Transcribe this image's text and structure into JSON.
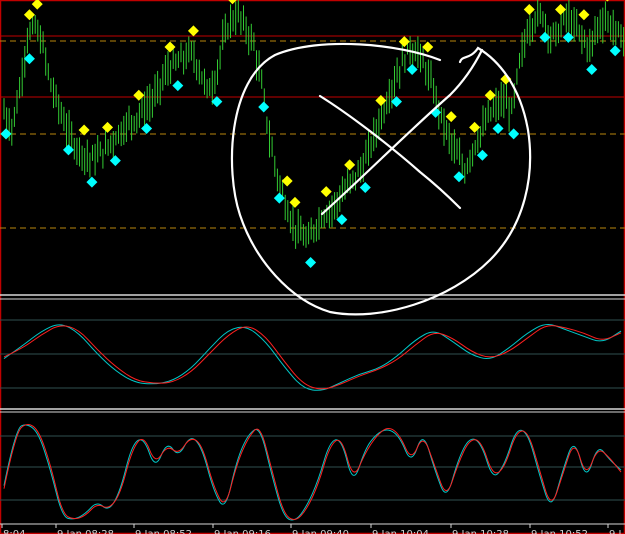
{
  "chart_data": [
    {
      "type": "candlestick",
      "panel": "price",
      "x_tick_labels": [
        "8:04",
        "9 Jan 08:28",
        "9 Jan 08:52",
        "9 Jan 09:16",
        "9 Jan 09:40",
        "9 Jan 10:04",
        "9 Jan 10:28",
        "9 Jan 10:52",
        "9 J"
      ],
      "close_trace": [
        0.62,
        0.56,
        0.7,
        0.9,
        0.94,
        0.86,
        0.72,
        0.64,
        0.56,
        0.5,
        0.47,
        0.44,
        0.46,
        0.48,
        0.52,
        0.55,
        0.58,
        0.6,
        0.64,
        0.66,
        0.72,
        0.78,
        0.8,
        0.82,
        0.84,
        0.78,
        0.7,
        0.74,
        0.88,
        0.96,
        0.98,
        0.93,
        0.87,
        0.72,
        0.52,
        0.38,
        0.28,
        0.2,
        0.16,
        0.14,
        0.2,
        0.24,
        0.26,
        0.3,
        0.34,
        0.38,
        0.42,
        0.5,
        0.58,
        0.66,
        0.74,
        0.8,
        0.86,
        0.84,
        0.78,
        0.7,
        0.6,
        0.52,
        0.46,
        0.4,
        0.48,
        0.54,
        0.6,
        0.64,
        0.66,
        0.62,
        0.8,
        0.92,
        0.97,
        0.98,
        0.9,
        0.92,
        0.98,
        0.94,
        0.9,
        0.86,
        0.94,
        0.97,
        0.93,
        0.9
      ],
      "dot_markers": [
        {
          "color": "#ffff00",
          "i": 0,
          "above": false
        },
        {
          "color": "#00ffff",
          "i": 0,
          "above": false
        },
        {
          "color": "#ffff00",
          "i": 3,
          "above": true
        },
        {
          "color": "#ffff00",
          "i": 4,
          "above": true
        },
        {
          "color": "#00ffff",
          "i": 3,
          "above": false
        },
        {
          "color": "#00ffff",
          "i": 8,
          "above": false
        },
        {
          "color": "#ffff00",
          "i": 10,
          "above": true
        },
        {
          "color": "#00ffff",
          "i": 11,
          "above": false
        },
        {
          "color": "#ffff00",
          "i": 13,
          "above": true
        },
        {
          "color": "#00ffff",
          "i": 14,
          "above": false
        },
        {
          "color": "#ffff00",
          "i": 17,
          "above": true
        },
        {
          "color": "#00ffff",
          "i": 18,
          "above": false
        },
        {
          "color": "#ffff00",
          "i": 21,
          "above": true
        },
        {
          "color": "#00ffff",
          "i": 22,
          "above": false
        },
        {
          "color": "#ffff00",
          "i": 24,
          "above": true
        },
        {
          "color": "#00ffff",
          "i": 27,
          "above": false
        },
        {
          "color": "#ffff00",
          "i": 29,
          "above": true
        },
        {
          "color": "#00ffff",
          "i": 33,
          "above": false
        },
        {
          "color": "#00ffff",
          "i": 35,
          "above": false
        },
        {
          "color": "#ffff00",
          "i": 36,
          "above": true
        },
        {
          "color": "#ffff00",
          "i": 37,
          "above": true
        },
        {
          "color": "#00ffff",
          "i": 39,
          "above": false
        },
        {
          "color": "#ffff00",
          "i": 41,
          "above": true
        },
        {
          "color": "#00ffff",
          "i": 43,
          "above": false
        },
        {
          "color": "#ffff00",
          "i": 44,
          "above": true
        },
        {
          "color": "#00ffff",
          "i": 46,
          "above": false
        },
        {
          "color": "#ffff00",
          "i": 48,
          "above": true
        },
        {
          "color": "#00ffff",
          "i": 50,
          "above": false
        },
        {
          "color": "#ffff00",
          "i": 51,
          "above": true
        },
        {
          "color": "#00ffff",
          "i": 52,
          "above": false
        },
        {
          "color": "#ffff00",
          "i": 54,
          "above": true
        },
        {
          "color": "#00ffff",
          "i": 55,
          "above": false
        },
        {
          "color": "#ffff00",
          "i": 57,
          "above": true
        },
        {
          "color": "#00ffff",
          "i": 58,
          "above": false
        },
        {
          "color": "#ffff00",
          "i": 60,
          "above": true
        },
        {
          "color": "#00ffff",
          "i": 61,
          "above": false
        },
        {
          "color": "#ffff00",
          "i": 62,
          "above": true
        },
        {
          "color": "#00ffff",
          "i": 63,
          "above": false
        },
        {
          "color": "#ffff00",
          "i": 64,
          "above": true
        },
        {
          "color": "#00ffff",
          "i": 65,
          "above": false
        },
        {
          "color": "#ffff00",
          "i": 67,
          "above": true
        },
        {
          "color": "#00ffff",
          "i": 69,
          "above": false
        },
        {
          "color": "#ffff00",
          "i": 71,
          "above": true
        },
        {
          "color": "#00ffff",
          "i": 72,
          "above": false
        },
        {
          "color": "#ffff00",
          "i": 74,
          "above": true
        },
        {
          "color": "#00ffff",
          "i": 75,
          "above": false
        },
        {
          "color": "#ffff00",
          "i": 77,
          "above": true
        },
        {
          "color": "#00ffff",
          "i": 78,
          "above": false
        }
      ]
    },
    {
      "type": "line",
      "panel": "oscillator-1",
      "series": [
        {
          "color": "#00c8c8",
          "values": [
            0.4,
            0.55,
            0.72,
            0.82,
            0.7,
            0.45,
            0.25,
            0.12,
            0.1,
            0.14,
            0.28,
            0.52,
            0.74,
            0.78,
            0.6,
            0.3,
            0.05,
            0.02,
            0.12,
            0.22,
            0.28,
            0.42,
            0.62,
            0.74,
            0.6,
            0.44,
            0.38,
            0.52,
            0.7,
            0.82,
            0.74,
            0.66,
            0.58,
            0.72
          ]
        },
        {
          "color": "#ff2020",
          "values": [
            0.42,
            0.52,
            0.68,
            0.8,
            0.74,
            0.5,
            0.3,
            0.15,
            0.11,
            0.12,
            0.24,
            0.46,
            0.68,
            0.8,
            0.66,
            0.36,
            0.1,
            0.03,
            0.1,
            0.2,
            0.27,
            0.38,
            0.56,
            0.72,
            0.64,
            0.48,
            0.4,
            0.48,
            0.64,
            0.8,
            0.76,
            0.7,
            0.6,
            0.7
          ]
        }
      ]
    },
    {
      "type": "line",
      "panel": "oscillator-2",
      "series": [
        {
          "color": "#00c8c8",
          "values": [
            0.35,
            0.9,
            0.95,
            0.85,
            0.5,
            0.05,
            0.02,
            0.08,
            0.2,
            0.1,
            0.3,
            0.75,
            0.82,
            0.5,
            0.78,
            0.62,
            0.84,
            0.72,
            0.3,
            0.1,
            0.6,
            0.85,
            0.92,
            0.45,
            0.05,
            0.0,
            0.15,
            0.4,
            0.78,
            0.8,
            0.35,
            0.7,
            0.85,
            0.9,
            0.82,
            0.55,
            0.88,
            0.5,
            0.2,
            0.6,
            0.82,
            0.76,
            0.4,
            0.55,
            0.9,
            0.86,
            0.45,
            0.1,
            0.5,
            0.82,
            0.38,
            0.75,
            0.6,
            0.5
          ]
        },
        {
          "color": "#ff2020",
          "values": [
            0.32,
            0.86,
            0.96,
            0.88,
            0.55,
            0.08,
            0.02,
            0.06,
            0.18,
            0.12,
            0.27,
            0.7,
            0.84,
            0.55,
            0.74,
            0.65,
            0.82,
            0.75,
            0.34,
            0.12,
            0.56,
            0.82,
            0.94,
            0.5,
            0.08,
            0.0,
            0.12,
            0.36,
            0.74,
            0.82,
            0.4,
            0.66,
            0.83,
            0.92,
            0.84,
            0.58,
            0.85,
            0.54,
            0.22,
            0.56,
            0.8,
            0.78,
            0.44,
            0.52,
            0.87,
            0.88,
            0.5,
            0.12,
            0.46,
            0.8,
            0.42,
            0.72,
            0.62,
            0.48
          ]
        }
      ]
    }
  ]
}
